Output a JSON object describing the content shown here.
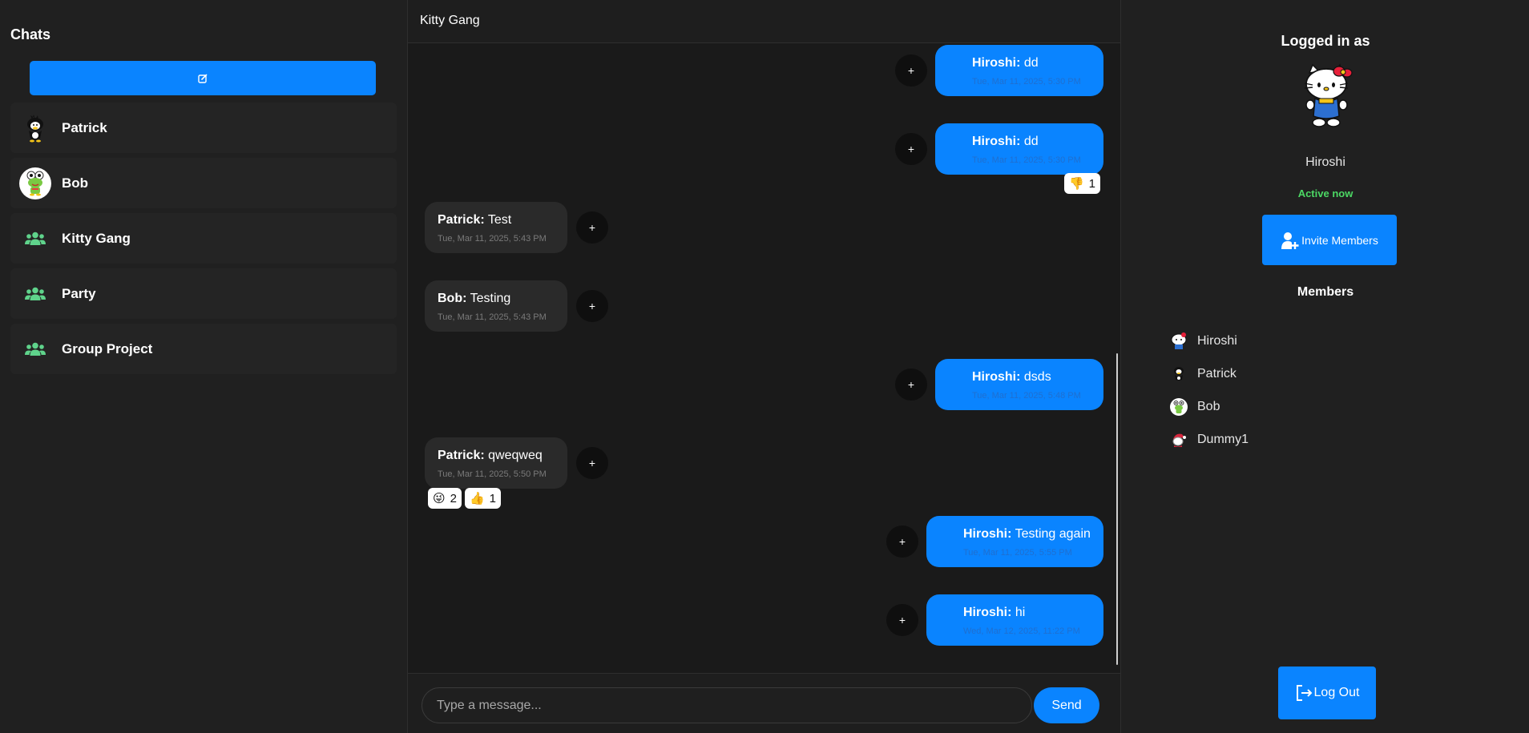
{
  "sidebar": {
    "title": "Chats",
    "new_chat_icon": "edit-icon",
    "chats": [
      {
        "name": "Patrick",
        "icon": "penguin-avatar"
      },
      {
        "name": "Bob",
        "icon": "frog-avatar"
      },
      {
        "name": "Kitty Gang",
        "icon": "group-icon"
      },
      {
        "name": "Party",
        "icon": "group-icon"
      },
      {
        "name": "Group Project",
        "icon": "group-icon"
      }
    ]
  },
  "header": {
    "title": "Kitty Gang"
  },
  "messages": [
    {
      "sender": "Hiroshi:",
      "text": "dd",
      "time": "Tue, Mar 11, 2025, 5:30 PM",
      "mine": true
    },
    {
      "sender": "Hiroshi:",
      "text": "dd",
      "time": "Tue, Mar 11, 2025, 5:30 PM",
      "mine": true,
      "reactions": [
        {
          "emoji": "👎",
          "count": "1"
        }
      ]
    },
    {
      "sender": "Patrick:",
      "text": "Test",
      "time": "Tue, Mar 11, 2025, 5:43 PM",
      "mine": false
    },
    {
      "sender": "Bob:",
      "text": "Testing",
      "time": "Tue, Mar 11, 2025, 5:43 PM",
      "mine": false
    },
    {
      "sender": "Hiroshi:",
      "text": "dsds",
      "time": "Tue, Mar 11, 2025, 5:48 PM",
      "mine": true
    },
    {
      "sender": "Patrick:",
      "text": "qweqweq",
      "time": "Tue, Mar 11, 2025, 5:50 PM",
      "mine": false,
      "reactions": [
        {
          "emoji": "😜",
          "count": "2"
        },
        {
          "emoji": "👍",
          "count": "1"
        }
      ]
    },
    {
      "sender": "Hiroshi:",
      "text": "Testing again",
      "time": "Tue, Mar 11, 2025, 5:55 PM",
      "mine": true
    },
    {
      "sender": "Hiroshi:",
      "text": "hi",
      "time": "Wed, Mar 12, 2025, 11:22 PM",
      "mine": true
    }
  ],
  "reaction_button_label": "+",
  "composer": {
    "placeholder": "Type a message...",
    "send_label": "Send"
  },
  "profile": {
    "logged_in_label": "Logged in as",
    "name": "Hiroshi",
    "status": "Active now",
    "invite_label": "Invite Members",
    "members_title": "Members",
    "members": [
      {
        "name": "Hiroshi",
        "icon": "kitty-avatar"
      },
      {
        "name": "Patrick",
        "icon": "penguin-avatar"
      },
      {
        "name": "Bob",
        "icon": "frog-avatar"
      },
      {
        "name": "Dummy1",
        "icon": "santa-avatar"
      }
    ],
    "logout_label": "Log Out"
  },
  "colors": {
    "accent": "#0a84ff",
    "status_green": "#4cd964",
    "group_icon": "#5fd38b"
  }
}
